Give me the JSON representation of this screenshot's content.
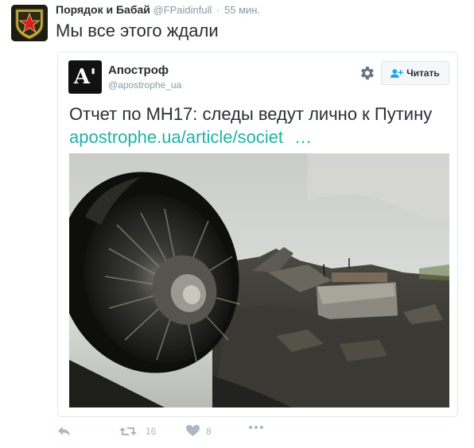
{
  "tweet": {
    "author_name": "Порядок и Бабай",
    "author_handle": "@FPaidinfull",
    "separator": "·",
    "timestamp": "55 мин.",
    "text": "Мы все этого ждали",
    "avatar_icon": "red-star-emblem-icon"
  },
  "quote": {
    "author_name": "Апостроф",
    "author_handle": "@apostrophe_ua",
    "avatar_glyph": "A'",
    "follow_label": "Читать",
    "text": "Отчет по МН17: следы ведут лично к Путину",
    "link_text": "apostrophe.ua/article/societ",
    "link_ellipsis": "…",
    "image_description_icon": "crash-debris-photo"
  },
  "actions": {
    "retweet_count": "16",
    "like_count": "8"
  },
  "colors": {
    "link": "#20b2a8",
    "muted": "#aab8c2",
    "text": "#292f33"
  }
}
